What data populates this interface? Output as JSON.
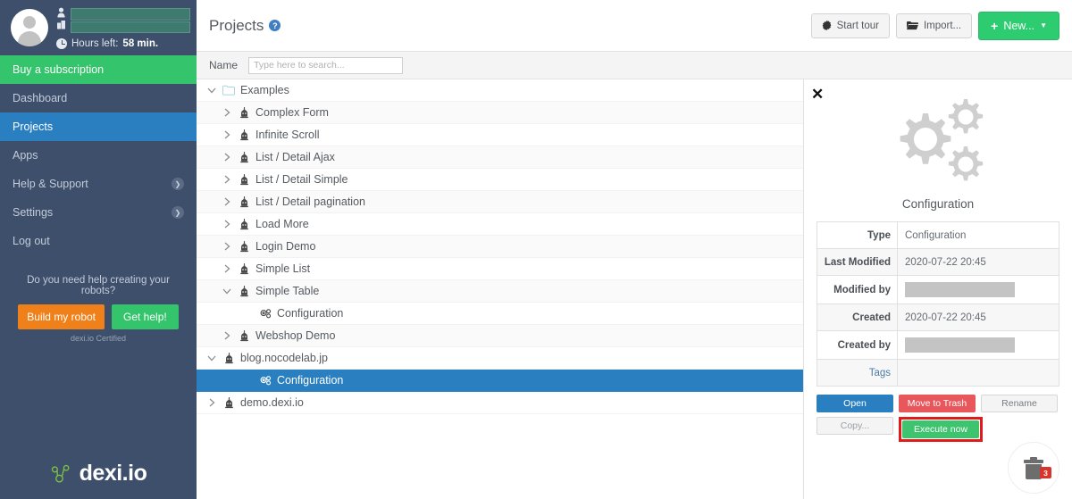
{
  "sidebar": {
    "hours_label": "Hours left:",
    "hours_value": "58 min.",
    "nav": [
      {
        "label": "Buy a subscription",
        "style": "buy",
        "chevron": false
      },
      {
        "label": "Dashboard",
        "style": "normal",
        "chevron": false
      },
      {
        "label": "Projects",
        "style": "active",
        "chevron": false
      },
      {
        "label": "Apps",
        "style": "normal",
        "chevron": false
      },
      {
        "label": "Help & Support",
        "style": "normal",
        "chevron": true
      },
      {
        "label": "Settings",
        "style": "normal",
        "chevron": true
      },
      {
        "label": "Log out",
        "style": "normal",
        "chevron": false
      }
    ],
    "help_question": "Do you need help creating your robots?",
    "build_button": "Build my robot",
    "gethelp_button": "Get help!",
    "certified": "dexi.io Certified",
    "brand": "dexi.io",
    "colors": {
      "background": "#3e4f6b",
      "active": "#2a7fc1",
      "buy": "#34c46b",
      "orange": "#f08019"
    }
  },
  "header": {
    "title": "Projects",
    "help_icon": "question-mark",
    "buttons": [
      {
        "label": "Start tour",
        "icon": "gear-badge-icon",
        "style": "default"
      },
      {
        "label": "Import...",
        "icon": "folder-icon",
        "style": "default"
      },
      {
        "label": "New...",
        "icon": "plus-icon",
        "style": "primary",
        "caret": true
      }
    ]
  },
  "search": {
    "label": "Name",
    "placeholder": "Type here to search...",
    "value": ""
  },
  "tree": {
    "rows": [
      {
        "label": "Examples",
        "indent": 0,
        "twisty": "down",
        "icon": "folder-icon",
        "selected": false
      },
      {
        "label": "Complex Form",
        "indent": 1,
        "twisty": "right",
        "icon": "robot-icon",
        "selected": false
      },
      {
        "label": "Infinite Scroll",
        "indent": 1,
        "twisty": "right",
        "icon": "robot-icon",
        "selected": false
      },
      {
        "label": "List / Detail Ajax",
        "indent": 1,
        "twisty": "right",
        "icon": "robot-icon",
        "selected": false
      },
      {
        "label": "List / Detail Simple",
        "indent": 1,
        "twisty": "right",
        "icon": "robot-icon",
        "selected": false
      },
      {
        "label": "List / Detail pagination",
        "indent": 1,
        "twisty": "right",
        "icon": "robot-icon",
        "selected": false
      },
      {
        "label": "Load More",
        "indent": 1,
        "twisty": "right",
        "icon": "robot-icon",
        "selected": false
      },
      {
        "label": "Login Demo",
        "indent": 1,
        "twisty": "right",
        "icon": "robot-icon",
        "selected": false
      },
      {
        "label": "Simple List",
        "indent": 1,
        "twisty": "right",
        "icon": "robot-icon",
        "selected": false
      },
      {
        "label": "Simple Table",
        "indent": 1,
        "twisty": "down",
        "icon": "robot-icon",
        "selected": false
      },
      {
        "label": "Configuration",
        "indent": 2,
        "twisty": "none",
        "icon": "gears-icon",
        "selected": false
      },
      {
        "label": "Webshop Demo",
        "indent": 1,
        "twisty": "right",
        "icon": "robot-icon",
        "selected": false
      },
      {
        "label": "blog.nocodelab.jp",
        "indent": 0,
        "twisty": "down",
        "icon": "robot-icon",
        "selected": false
      },
      {
        "label": "Configuration",
        "indent": 2,
        "twisty": "none",
        "icon": "gears-icon",
        "selected": true
      },
      {
        "label": "demo.dexi.io",
        "indent": 0,
        "twisty": "right",
        "icon": "robot-icon",
        "selected": false
      }
    ]
  },
  "detail": {
    "close_icon": "close-icon",
    "hero_icon": "gears-icon",
    "hero_title": "Configuration",
    "meta": [
      {
        "key": "Type",
        "value": "Configuration",
        "redacted": false,
        "link": false
      },
      {
        "key": "Last Modified",
        "value": "2020-07-22 20:45",
        "redacted": false,
        "link": false
      },
      {
        "key": "Modified by",
        "value": "",
        "redacted": true,
        "link": false
      },
      {
        "key": "Created",
        "value": "2020-07-22 20:45",
        "redacted": false,
        "link": false
      },
      {
        "key": "Created by",
        "value": "",
        "redacted": true,
        "link": false
      },
      {
        "key": "Tags",
        "value": "",
        "redacted": false,
        "link": true
      }
    ],
    "buttons": [
      {
        "label": "Open",
        "style": "open",
        "highlighted": false
      },
      {
        "label": "Move to Trash",
        "style": "trash",
        "highlighted": false
      },
      {
        "label": "Rename",
        "style": "rename",
        "highlighted": false
      },
      {
        "label": "Copy...",
        "style": "copy",
        "highlighted": false
      },
      {
        "label": "Execute now",
        "style": "exec",
        "highlighted": true
      }
    ],
    "trash_widget": {
      "icon": "trash-icon",
      "badge": "3"
    }
  }
}
